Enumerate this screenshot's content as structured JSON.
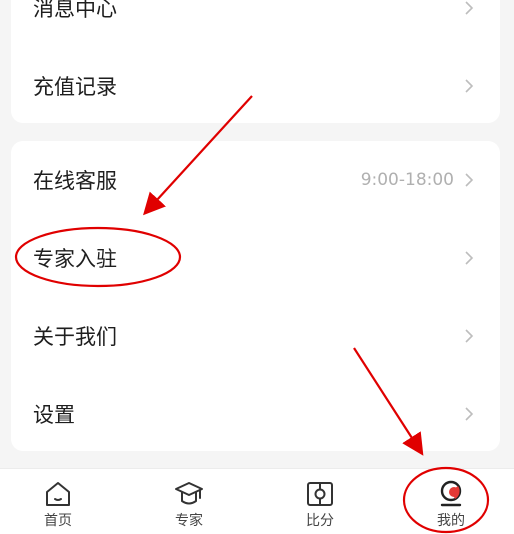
{
  "menu": {
    "group1": [
      {
        "label": "消息中心",
        "value": ""
      },
      {
        "label": "充值记录",
        "value": ""
      }
    ],
    "group2": [
      {
        "label": "在线客服",
        "value": "9:00-18:00"
      },
      {
        "label": "专家入驻",
        "value": ""
      },
      {
        "label": "关于我们",
        "value": ""
      },
      {
        "label": "设置",
        "value": ""
      }
    ]
  },
  "tabbar": {
    "items": [
      {
        "label": "首页",
        "icon": "home-icon",
        "active": false
      },
      {
        "label": "专家",
        "icon": "graduation-cap-icon",
        "active": false
      },
      {
        "label": "比分",
        "icon": "score-icon",
        "active": false
      },
      {
        "label": "我的",
        "icon": "profile-icon",
        "active": true
      }
    ]
  },
  "colors": {
    "accent": "#e53935",
    "annotation": "#e00000",
    "chevron": "#bdbdbd",
    "background": "#f5f5f5"
  }
}
